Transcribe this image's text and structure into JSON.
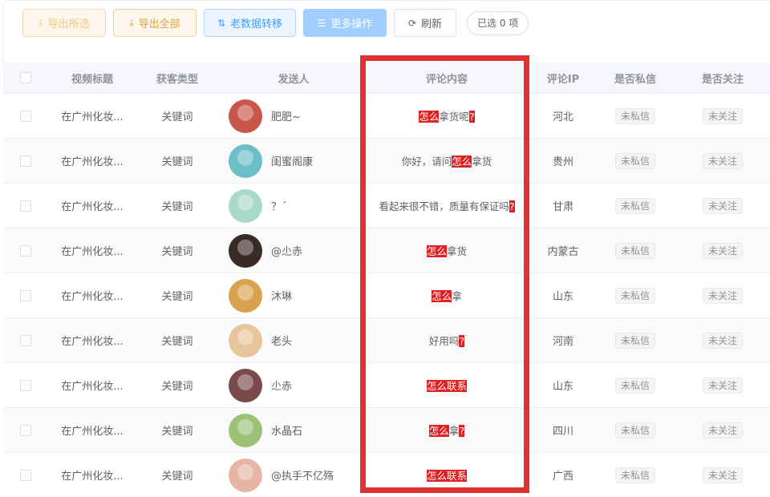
{
  "toolbar": {
    "export_selected": "导出所选",
    "export_all": "导出全部",
    "migrate_old": "老数据转移",
    "more_actions": "更多操作",
    "refresh": "刷新",
    "selected_count": "已选 0 项"
  },
  "table": {
    "headers": {
      "title": "视频标题",
      "type": "获客类型",
      "sender": "发送人",
      "comment": "评论内容",
      "ip": "评论IP",
      "dm": "是否私信",
      "follow": "是否关注"
    },
    "rows": [
      {
        "title": "在广州化妆...",
        "type": "关键词",
        "sender": "肥肥~",
        "comment": [
          {
            "t": "怎么",
            "hl": true
          },
          {
            "t": "拿货呢",
            "hl": false
          },
          {
            "t": "?",
            "hl": true
          }
        ],
        "ip": "河北",
        "dm": "未私信",
        "follow": "未关注",
        "avatar": "#c9564a"
      },
      {
        "title": "在广州化妆...",
        "type": "关键词",
        "sender": "闺蜜阁康",
        "comment": [
          {
            "t": "你好，请问",
            "hl": false
          },
          {
            "t": "怎么",
            "hl": true
          },
          {
            "t": "拿货",
            "hl": false
          }
        ],
        "ip": "贵州",
        "dm": "未私信",
        "follow": "未关注",
        "avatar": "#6bbfc7"
      },
      {
        "title": "在广州化妆...",
        "type": "关键词",
        "sender": "？ˊ",
        "comment": [
          {
            "t": "看起来很不错，质量有保证吗",
            "hl": false
          },
          {
            "t": "?",
            "hl": true
          }
        ],
        "ip": "甘肃",
        "dm": "未私信",
        "follow": "未关注",
        "avatar": "#a9d9c9"
      },
      {
        "title": "在广州化妆...",
        "type": "关键词",
        "sender": "@尐赤",
        "comment": [
          {
            "t": "怎么",
            "hl": true
          },
          {
            "t": "拿货",
            "hl": false
          }
        ],
        "ip": "内蒙古",
        "dm": "未私信",
        "follow": "未关注",
        "avatar": "#3a2a26"
      },
      {
        "title": "在广州化妆...",
        "type": "关键词",
        "sender": "沐琳",
        "comment": [
          {
            "t": "怎么",
            "hl": true
          },
          {
            "t": "拿",
            "hl": false
          }
        ],
        "ip": "山东",
        "dm": "未私信",
        "follow": "未关注",
        "avatar": "#d9a24e"
      },
      {
        "title": "在广州化妆...",
        "type": "关键词",
        "sender": "老头",
        "comment": [
          {
            "t": "好用吗",
            "hl": false
          },
          {
            "t": "?",
            "hl": true
          }
        ],
        "ip": "河南",
        "dm": "未私信",
        "follow": "未关注",
        "avatar": "#e8c49a"
      },
      {
        "title": "在广州化妆...",
        "type": "关键词",
        "sender": "尐赤",
        "comment": [
          {
            "t": "怎么联系",
            "hl": true
          }
        ],
        "ip": "山东",
        "dm": "未私信",
        "follow": "未关注",
        "avatar": "#7a4a4a"
      },
      {
        "title": "在广州化妆...",
        "type": "关键词",
        "sender": "水晶石",
        "comment": [
          {
            "t": "怎么",
            "hl": true
          },
          {
            "t": "拿",
            "hl": false
          },
          {
            "t": "?",
            "hl": true
          }
        ],
        "ip": "四川",
        "dm": "未私信",
        "follow": "未关注",
        "avatar": "#9cc27a"
      },
      {
        "title": "在广州化妆...",
        "type": "关键词",
        "sender": "@执手不亿殇",
        "comment": [
          {
            "t": "怎么联系",
            "hl": true
          }
        ],
        "ip": "广西",
        "dm": "未私信",
        "follow": "未关注",
        "avatar": "#e6b5a5"
      }
    ]
  }
}
